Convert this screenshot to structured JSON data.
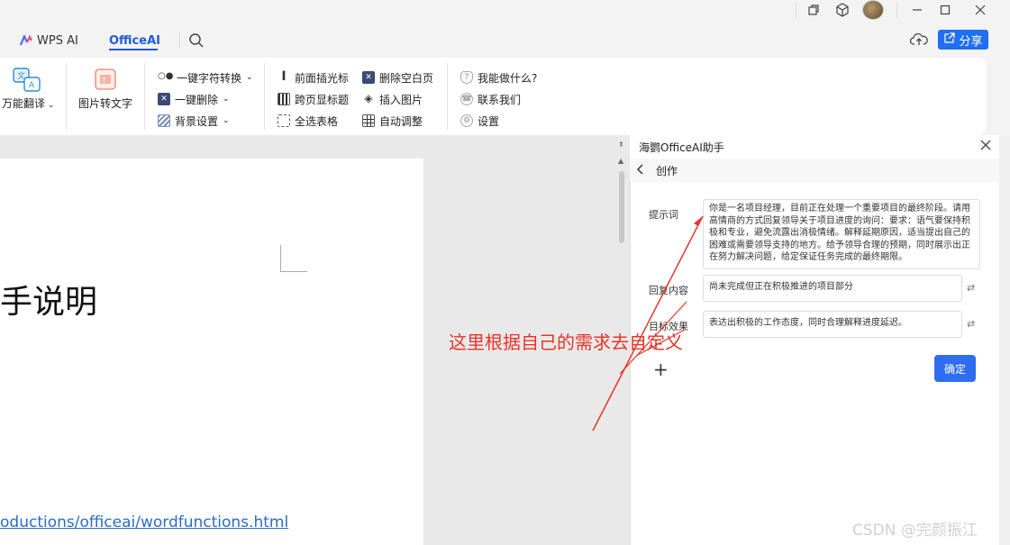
{
  "colors": {
    "accent": "#1e5bd6",
    "primary_button": "#2f6df0",
    "annotation_red": "#e8342a"
  },
  "window": {
    "controls": [
      "minimize-icon",
      "maximize-icon",
      "close-icon"
    ]
  },
  "tabs": [
    {
      "label": "WPS AI",
      "icon": "wps-ai-logo-icon",
      "active": false
    },
    {
      "label": "OfficeAI",
      "active": true
    }
  ],
  "top_right": {
    "share_label": "分享",
    "cloud_icon": "cloud-upload-icon"
  },
  "ribbon": {
    "translate": {
      "label": "万能翻译",
      "icon": "translate-icon"
    },
    "image_to_text": {
      "label": "图片转文字",
      "icon": "image-to-text-icon"
    },
    "group2": [
      {
        "label": "一键字符转换",
        "icon": "char-convert-icon",
        "dropdown": true
      },
      {
        "label": "一键删除",
        "icon": "delete-icon",
        "dropdown": true
      },
      {
        "label": "背景设置",
        "icon": "background-icon",
        "dropdown": true
      }
    ],
    "group3_col1": [
      {
        "label": "前面插光标",
        "icon": "cursor-insert-icon"
      },
      {
        "label": "跨页显标题",
        "icon": "repeat-header-icon"
      },
      {
        "label": "全选表格",
        "icon": "select-table-icon"
      }
    ],
    "group3_col2": [
      {
        "label": "删除空白页",
        "icon": "delete-blank-page-icon"
      },
      {
        "label": "插入图片",
        "icon": "insert-image-icon"
      },
      {
        "label": "自动调整",
        "icon": "auto-fit-table-icon"
      }
    ],
    "group4": [
      {
        "label": "我能做什么?",
        "icon": "help-shield-icon"
      },
      {
        "label": "联系我们",
        "icon": "contact-icon"
      },
      {
        "label": "设置",
        "icon": "settings-gear-icon"
      }
    ]
  },
  "document": {
    "title_fragment": "手说明",
    "link_fragment": "oductions/officeai/wordfunctions.html"
  },
  "panel": {
    "title": "海鹦OfficeAI助手",
    "back_label": "创作",
    "fields": [
      {
        "label": "提示词",
        "value": "你是一名项目经理，目前正在处理一个重要项目的最终阶段。请用高情商的方式回复领导关于项目进度的询问：要求：语气要保持积极和专业，避免流露出消极情绪。解释延期原因，适当提出自己的困难或需要领导支持的地方。给予领导合理的预期，同时展示出正在努力解决问题，给定保证任务完成的最终期限。"
      },
      {
        "label": "回复内容",
        "value": "尚未完成但正在积极推进的项目部分"
      },
      {
        "label": "目标效果",
        "value": "表达出积极的工作态度，同时合理解释进度延迟。"
      }
    ],
    "add_label": "+",
    "confirm_label": "确定"
  },
  "annotation": {
    "text": "这里根据自己的需求去自定义"
  },
  "watermark": "CSDN @完颜振江"
}
